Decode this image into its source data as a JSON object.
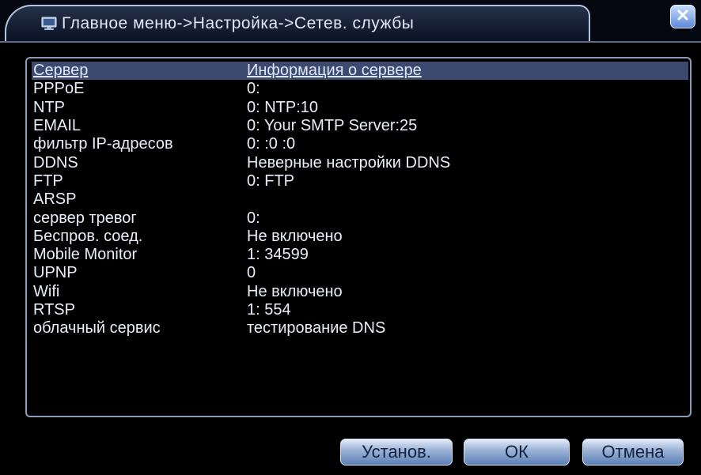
{
  "window": {
    "title": "Главное меню->Настройка->Сетев. службы",
    "icons": {
      "menu": "monitor-icon",
      "close": "close-icon"
    },
    "colors": {
      "background": "#000000",
      "accent": "#3c4a70",
      "button": "#7f9ccb"
    }
  },
  "table": {
    "headers": {
      "server": "Сервер",
      "info": "Информация о сервере"
    },
    "rows": [
      {
        "server": "PPPoE",
        "info": "0:"
      },
      {
        "server": "NTP",
        "info": "0: NTP:10"
      },
      {
        "server": "EMAIL",
        "info": "0: Your SMTP Server:25"
      },
      {
        "server": "фильтр IP-адресов",
        "info": "0: :0 :0"
      },
      {
        "server": "DDNS",
        "info": "Неверные настройки DDNS"
      },
      {
        "server": "FTP",
        "info": "0: FTP"
      },
      {
        "server": "ARSP",
        "info": ""
      },
      {
        "server": "сервер тревог",
        "info": "0:"
      },
      {
        "server": "Беспров. соед.",
        "info": "Не включено"
      },
      {
        "server": "Mobile Monitor",
        "info": "1: 34599"
      },
      {
        "server": "UPNP",
        "info": "0"
      },
      {
        "server": "Wifi",
        "info": "Не включено"
      },
      {
        "server": "RTSP",
        "info": "1: 554"
      },
      {
        "server": "облачный сервис",
        "info": "тестирование DNS"
      }
    ]
  },
  "buttons": {
    "set": "Установ.",
    "ok": "ОК",
    "cancel": "Отмена"
  }
}
